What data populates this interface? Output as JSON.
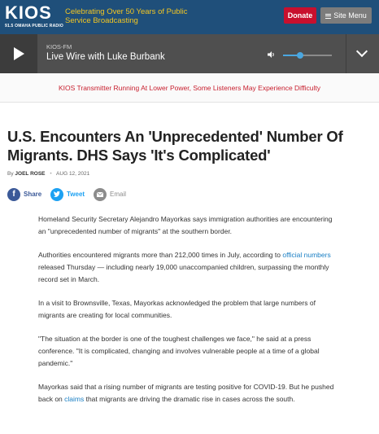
{
  "header": {
    "logo": "KIOS",
    "logo_sub": "91.5 OMAHA PUBLIC RADIO",
    "tagline": "Celebrating Over 50 Years of Public Service Broadcasting",
    "donate_label": "Donate",
    "menu_label": "Site Menu",
    "colors": {
      "bar": "#1f4f7a",
      "tagline": "#f3c623",
      "donate": "#c8102e",
      "menu": "#7c7c7c"
    }
  },
  "player": {
    "station": "KIOS-FM",
    "show": "Live Wire with Luke Burbank",
    "volume_level": 0.35,
    "icons": {
      "play": "play-icon",
      "volume": "volume-icon",
      "expand": "chevron-down-icon"
    }
  },
  "alert": {
    "text": "KIOS Transmitter Running At Lower Power, Some Listeners May Experience Difficulty"
  },
  "article": {
    "headline": "U.S. Encounters An 'Unprecedented' Number Of Migrants. DHS Says 'It's Complicated'",
    "by": "By",
    "author": "JOEL ROSE",
    "date": "AUG 12, 2021",
    "share": {
      "facebook": "Share",
      "twitter": "Tweet",
      "email": "Email"
    },
    "p1": "Homeland Security Secretary Alejandro Mayorkas says immigration authorities are encountering an \"unprecedented number of migrants\" at the southern border.",
    "p2_a": "Authorities encountered migrants more than 212,000 times in July, according to ",
    "p2_link": "official numbers",
    "p2_b": " released Thursday — including nearly 19,000 unaccompanied children, surpassing the monthly record set in March.",
    "p3": "In a visit to Brownsville, Texas, Mayorkas acknowledged the problem that large numbers of migrants are creating for local communities.",
    "p4": "\"The situation at the border is one of the toughest challenges we face,\" he said at a press conference. \"It is complicated, changing and involves vulnerable people at a time of a global pandemic.\"",
    "p5_a": "Mayorkas said that a rising number of migrants are testing positive for COVID-19. But he pushed back on ",
    "p5_link": "claims",
    "p5_b": " that migrants are driving the dramatic rise in cases across the south."
  }
}
